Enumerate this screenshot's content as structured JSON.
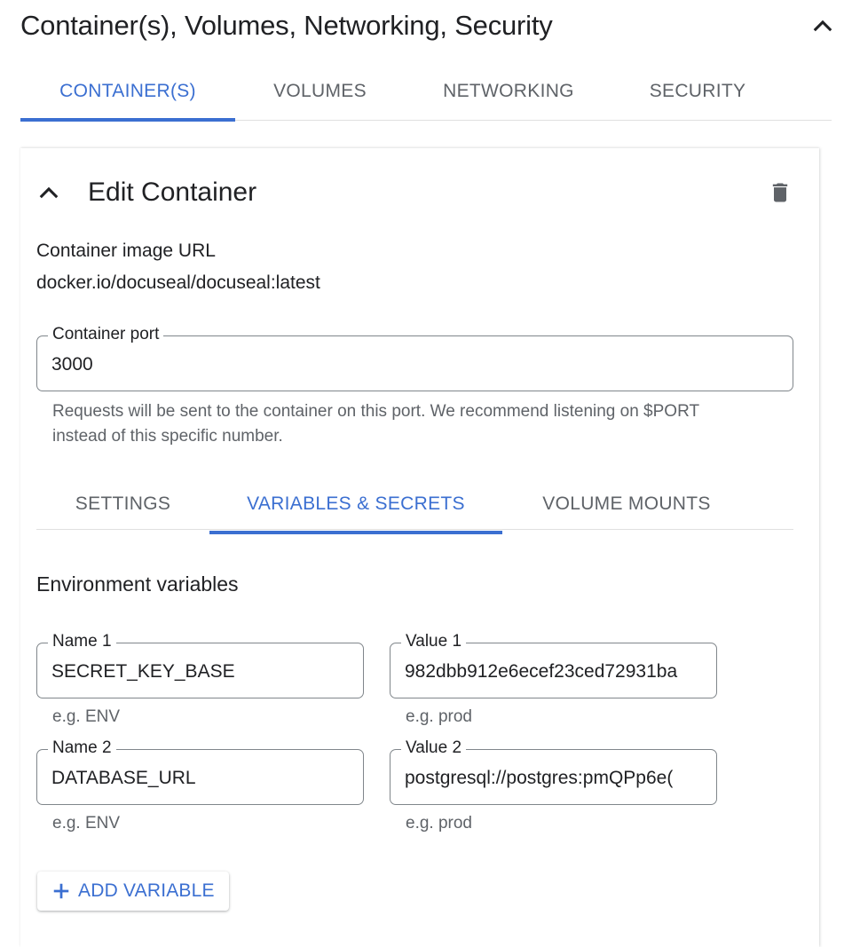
{
  "section": {
    "title": "Container(s), Volumes, Networking, Security",
    "collapse_icon": "chevron-up-icon"
  },
  "top_tabs": [
    {
      "label": "CONTAINER(S)",
      "active": true
    },
    {
      "label": "VOLUMES",
      "active": false
    },
    {
      "label": "NETWORKING",
      "active": false
    },
    {
      "label": "SECURITY",
      "active": false
    }
  ],
  "edit_container": {
    "title": "Edit Container",
    "collapse_icon": "chevron-up-icon",
    "delete_icon": "trash-icon",
    "image_label": "Container image URL",
    "image_value": "docker.io/docuseal/docuseal:latest",
    "port": {
      "label": "Container port",
      "value": "3000",
      "hint": "Requests will be sent to the container on this port. We recommend listening on $PORT instead of this specific number."
    }
  },
  "sub_tabs": [
    {
      "label": "SETTINGS",
      "active": false
    },
    {
      "label": "VARIABLES & SECRETS",
      "active": true
    },
    {
      "label": "VOLUME MOUNTS",
      "active": false
    }
  ],
  "env": {
    "heading": "Environment variables",
    "variables": [
      {
        "name_label": "Name 1",
        "name_value": "SECRET_KEY_BASE",
        "name_hint": "e.g. ENV",
        "value_label": "Value 1",
        "value_value": "982dbb912e6ecef23ced72931ba",
        "value_hint": "e.g. prod"
      },
      {
        "name_label": "Name 2",
        "name_value": "DATABASE_URL",
        "name_hint": "e.g. ENV",
        "value_label": "Value 2",
        "value_value": "postgresql://postgres:pmQPp6e(",
        "value_hint": "e.g. prod"
      }
    ],
    "add_button": {
      "label": "ADD VARIABLE",
      "icon": "plus-icon"
    }
  },
  "colors": {
    "accent": "#3b6fd1",
    "text": "#202124",
    "muted": "#5f6368",
    "border": "#80868b",
    "divider": "#e0e0e0"
  }
}
